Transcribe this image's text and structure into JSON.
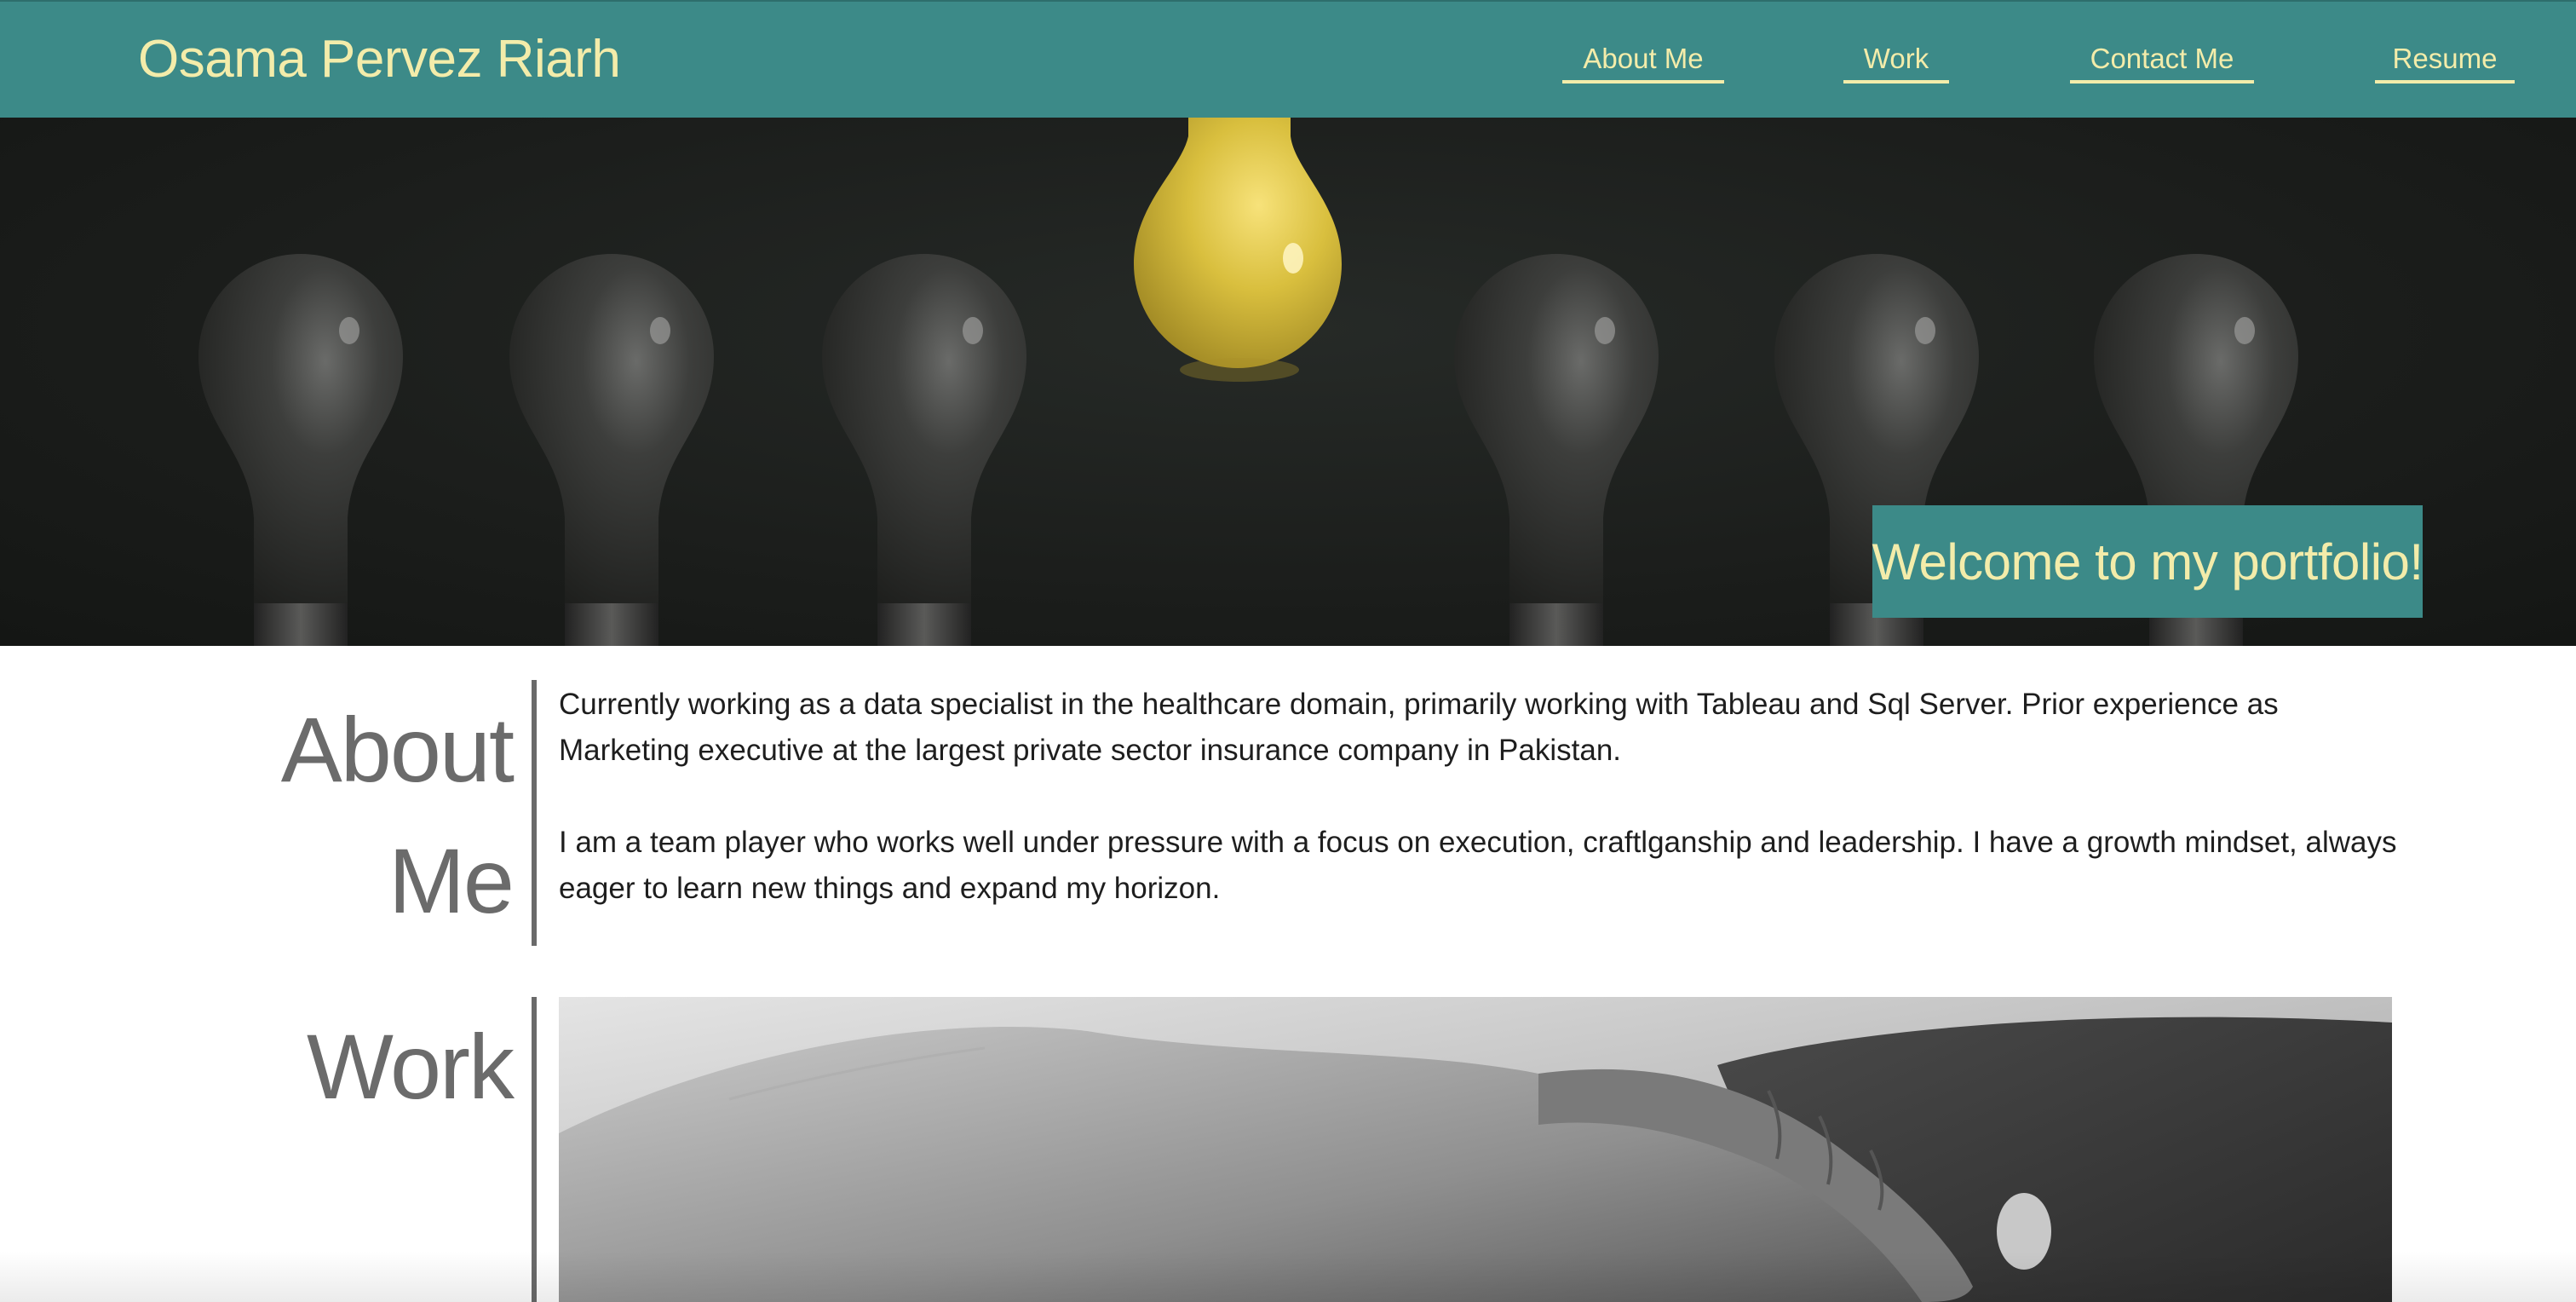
{
  "header": {
    "title": "Osama Pervez Riarh",
    "nav": [
      {
        "label": "About Me"
      },
      {
        "label": "Work"
      },
      {
        "label": "Contact Me"
      },
      {
        "label": "Resume"
      }
    ]
  },
  "hero": {
    "welcome": "Welcome to my portfolio!",
    "image": "lightbulbs-image"
  },
  "about": {
    "heading_line1": "About",
    "heading_line2": "Me",
    "paragraphs": [
      "Currently working as a data specialist in the healthcare domain, primarily working with Tableau and Sql Server. Prior experience as Marketing executive at the largest private sector insurance company in Pakistan.",
      "I am a team player who works well under pressure with a focus on execution, craftlganship and leadership. I have a growth mindset, always eager to learn new things and expand my horizon."
    ]
  },
  "work": {
    "heading": "Work",
    "image": "handshake-image"
  },
  "colors": {
    "header_bg": "#3c8a88",
    "accent_text": "#f3ecaa",
    "heading_gray": "#6b6b6b",
    "bulb_yellow": "#e5c94a"
  }
}
